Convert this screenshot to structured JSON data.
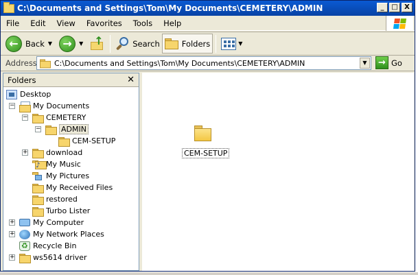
{
  "window": {
    "title": "C:\\Documents and Settings\\Tom\\My Documents\\CEMETERY\\ADMIN",
    "buttons": {
      "minimize": "_",
      "maximize": "□",
      "close": "X"
    }
  },
  "menu": [
    "File",
    "Edit",
    "View",
    "Favorites",
    "Tools",
    "Help"
  ],
  "toolbar": {
    "back_label": "Back",
    "search_label": "Search",
    "folders_label": "Folders"
  },
  "address": {
    "label": "Address",
    "value": "C:\\Documents and Settings\\Tom\\My Documents\\CEMETERY\\ADMIN",
    "go_label": "Go"
  },
  "folders_pane": {
    "title": "Folders",
    "close": "✕",
    "tree": [
      {
        "label": "Desktop",
        "icon": "desktop-icon"
      },
      {
        "label": "My Documents",
        "icon": "documents-icon",
        "expander": "−"
      },
      {
        "label": "CEMETERY",
        "icon": "folder-icon",
        "expander": "−"
      },
      {
        "label": "ADMIN",
        "icon": "folder-open-icon",
        "expander": "−",
        "selected": true
      },
      {
        "label": "CEM-SETUP",
        "icon": "folder-icon"
      },
      {
        "label": "download",
        "icon": "folder-icon",
        "expander": "+"
      },
      {
        "label": "My Music",
        "icon": "music-folder-icon"
      },
      {
        "label": "My Pictures",
        "icon": "pictures-folder-icon"
      },
      {
        "label": "My Received Files",
        "icon": "folder-icon"
      },
      {
        "label": "restored",
        "icon": "folder-icon"
      },
      {
        "label": "Turbo Lister",
        "icon": "folder-icon"
      },
      {
        "label": "My Computer",
        "icon": "computer-icon",
        "expander": "+"
      },
      {
        "label": "My Network Places",
        "icon": "network-icon",
        "expander": "+"
      },
      {
        "label": "Recycle Bin",
        "icon": "recycle-bin-icon"
      },
      {
        "label": "ws5614 driver",
        "icon": "folder-icon",
        "expander": "+"
      }
    ]
  },
  "content": {
    "items": [
      {
        "label": "CEM-SETUP",
        "icon": "folder-icon"
      }
    ]
  }
}
